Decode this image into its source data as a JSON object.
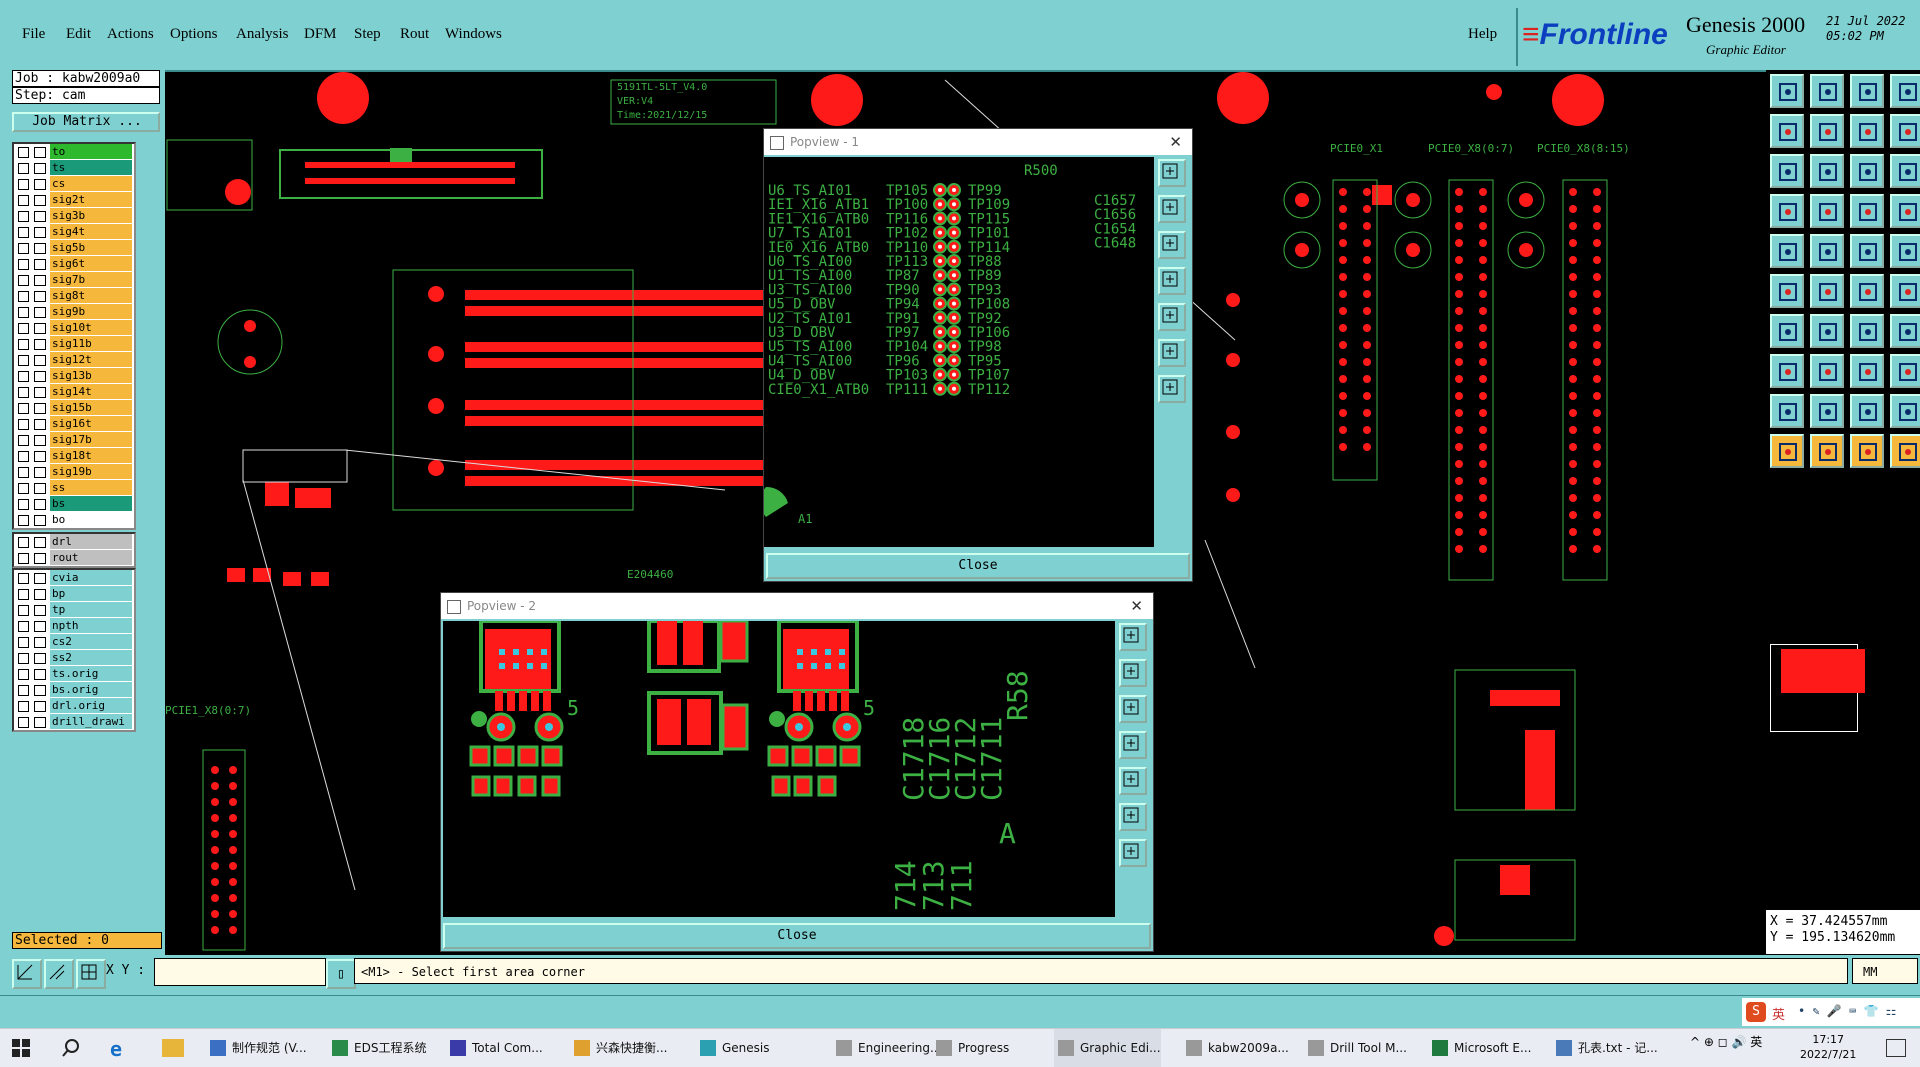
{
  "menu": {
    "items": [
      "File",
      "Edit",
      "Actions",
      "Options",
      "Analysis",
      "DFM",
      "Step",
      "Rout",
      "Windows"
    ],
    "help": "Help"
  },
  "brand": {
    "logo": "Frontline",
    "product": "Genesis 2000",
    "subtitle": "Graphic Editor",
    "date": "21 Jul 2022",
    "time": "05:02 PM"
  },
  "job": {
    "job_line": "Job : kabw2009a0",
    "step_line": "Step: cam",
    "matrix_button": "Job Matrix ..."
  },
  "layers": {
    "board": [
      {
        "name": "to",
        "color": "#2eb82e"
      },
      {
        "name": "ts",
        "color": "#1b9a7a"
      },
      {
        "name": "cs",
        "color": "#f5b83d"
      },
      {
        "name": "sig2t",
        "color": "#f5b83d"
      },
      {
        "name": "sig3b",
        "color": "#f5b83d"
      },
      {
        "name": "sig4t",
        "color": "#f5b83d"
      },
      {
        "name": "sig5b",
        "color": "#f5b83d"
      },
      {
        "name": "sig6t",
        "color": "#f5b83d"
      },
      {
        "name": "sig7b",
        "color": "#f5b83d"
      },
      {
        "name": "sig8t",
        "color": "#f5b83d"
      },
      {
        "name": "sig9b",
        "color": "#f5b83d"
      },
      {
        "name": "sig10t",
        "color": "#f5b83d"
      },
      {
        "name": "sig11b",
        "color": "#f5b83d"
      },
      {
        "name": "sig12t",
        "color": "#f5b83d"
      },
      {
        "name": "sig13b",
        "color": "#f5b83d"
      },
      {
        "name": "sig14t",
        "color": "#f5b83d"
      },
      {
        "name": "sig15b",
        "color": "#f5b83d"
      },
      {
        "name": "sig16t",
        "color": "#f5b83d"
      },
      {
        "name": "sig17b",
        "color": "#f5b83d"
      },
      {
        "name": "sig18t",
        "color": "#f5b83d"
      },
      {
        "name": "sig19b",
        "color": "#f5b83d"
      },
      {
        "name": "ss",
        "color": "#f5b83d"
      },
      {
        "name": "bs",
        "color": "#1b9a7a"
      },
      {
        "name": "bo",
        "color": "#ffffff"
      }
    ],
    "drill": [
      {
        "name": "drl",
        "color": "#bfbfbf"
      },
      {
        "name": "rout",
        "color": "#bfbfbf"
      }
    ],
    "misc": [
      {
        "name": "cvia",
        "color": "#7fd1d1"
      },
      {
        "name": "bp",
        "color": "#7fd1d1"
      },
      {
        "name": "tp",
        "color": "#7fd1d1"
      },
      {
        "name": "npth",
        "color": "#7fd1d1"
      },
      {
        "name": "cs2",
        "color": "#7fd1d1"
      },
      {
        "name": "ss2",
        "color": "#7fd1d1"
      },
      {
        "name": "ts.orig",
        "color": "#7fd1d1"
      },
      {
        "name": "bs.orig",
        "color": "#7fd1d1"
      },
      {
        "name": "drl.orig",
        "color": "#7fd1d1"
      },
      {
        "name": "drill_drawi",
        "color": "#7fd1d1"
      }
    ],
    "selected_label": "Selected : 0"
  },
  "board_text": {
    "title_box": [
      "5191TL-5LT_V4.0",
      "VER:V4",
      "Time:2021/12/15"
    ],
    "pcie_labels": [
      "PCIE0_X1",
      "PCIE0_X8(0:7)",
      "PCIE0_X8(8:15)"
    ],
    "pcie_bottom": "PCIE1_X8(0:7)",
    "lower_part": "E204460"
  },
  "popup1": {
    "title": "Popview - 1",
    "left_col": [
      "U6_TS_AI01",
      "IE1_X16_ATB1",
      "IE1_X16_ATB0",
      "U7_TS_AI01",
      "IE0_X16_ATB0",
      "U0_TS_AI00",
      "U1_TS_AI00",
      "U3_TS_AI00",
      "U5_D_OBV",
      "U2_TS_AI01",
      "U3_D_OBV",
      "U5_TS_AI00",
      "U4_TS_AI00",
      "U4_D_OBV",
      "CIE0_X1_ATB0"
    ],
    "mid_col": [
      "TP105",
      "TP100",
      "TP116",
      "TP102",
      "TP110",
      "TP113",
      "TP87",
      "TP90",
      "TP94",
      "TP91",
      "TP97",
      "TP104",
      "TP96",
      "TP103",
      "TP111"
    ],
    "right_col": [
      "TP99",
      "TP109",
      "TP115",
      "TP101",
      "TP114",
      "TP88",
      "TP89",
      "TP93",
      "TP108",
      "TP92",
      "TP106",
      "TP98",
      "TP95",
      "TP107",
      "TP112"
    ],
    "corner_labels": [
      "R500",
      "C1657",
      "C1656",
      "C1654",
      "C1648"
    ],
    "a1": "A1",
    "close": "Close"
  },
  "popup2": {
    "title": "Popview - 2",
    "side_labels": [
      "C1718",
      "C1716",
      "C1712",
      "C1711",
      "R58"
    ],
    "bottom_labels": [
      "714",
      "713",
      "711",
      "A"
    ],
    "digit": "5",
    "close": "Close"
  },
  "coords": {
    "x": "X = 37.424557mm",
    "y": "Y = 195.134620mm"
  },
  "status": {
    "xy_label": "X Y :",
    "xy_value": "",
    "message": "<M1> - Select first area corner",
    "mode": "MM"
  },
  "taskbar": {
    "items": [
      "制作规范 (V...",
      "EDS工程系统",
      "Total Com...",
      "兴森快捷衡...",
      "Genesis",
      "Engineering...",
      "Progress",
      "Graphic Edi...",
      "kabw2009a...",
      "Drill Tool M...",
      "Microsoft E...",
      "孔表.txt - 记..."
    ],
    "time": "17:17",
    "date": "2022/7/21",
    "ime": "英"
  },
  "colors": {
    "panel": "#7fd1d1",
    "copper": "#ff1a1a",
    "silk": "#3cb043",
    "background": "#000000"
  }
}
